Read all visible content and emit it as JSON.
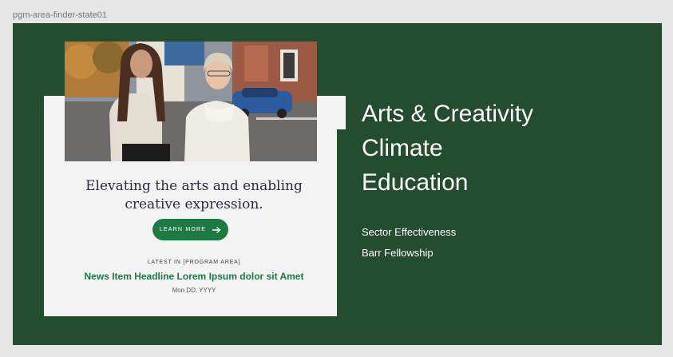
{
  "frame": {
    "label": "pgm-area-finder-state01"
  },
  "card": {
    "tagline": "Elevating the arts and enabling creative expression.",
    "button": {
      "label": "LEARN MORE",
      "icon": "arrow-right-icon"
    },
    "latest_label": "LATEST IN [PROGRAM AREA]",
    "news_headline": "News Item Headline Lorem Ipsum dolor sit Amet",
    "news_date": "Mon DD, YYYY"
  },
  "program_areas": [
    "Arts & Creativity",
    "Climate",
    "Education"
  ],
  "secondary_links": [
    "Sector Effectiveness",
    "Barr Fellowship"
  ],
  "colors": {
    "background": "#234d2e",
    "accent": "#1e7a45",
    "card": "#f3f3f3"
  }
}
